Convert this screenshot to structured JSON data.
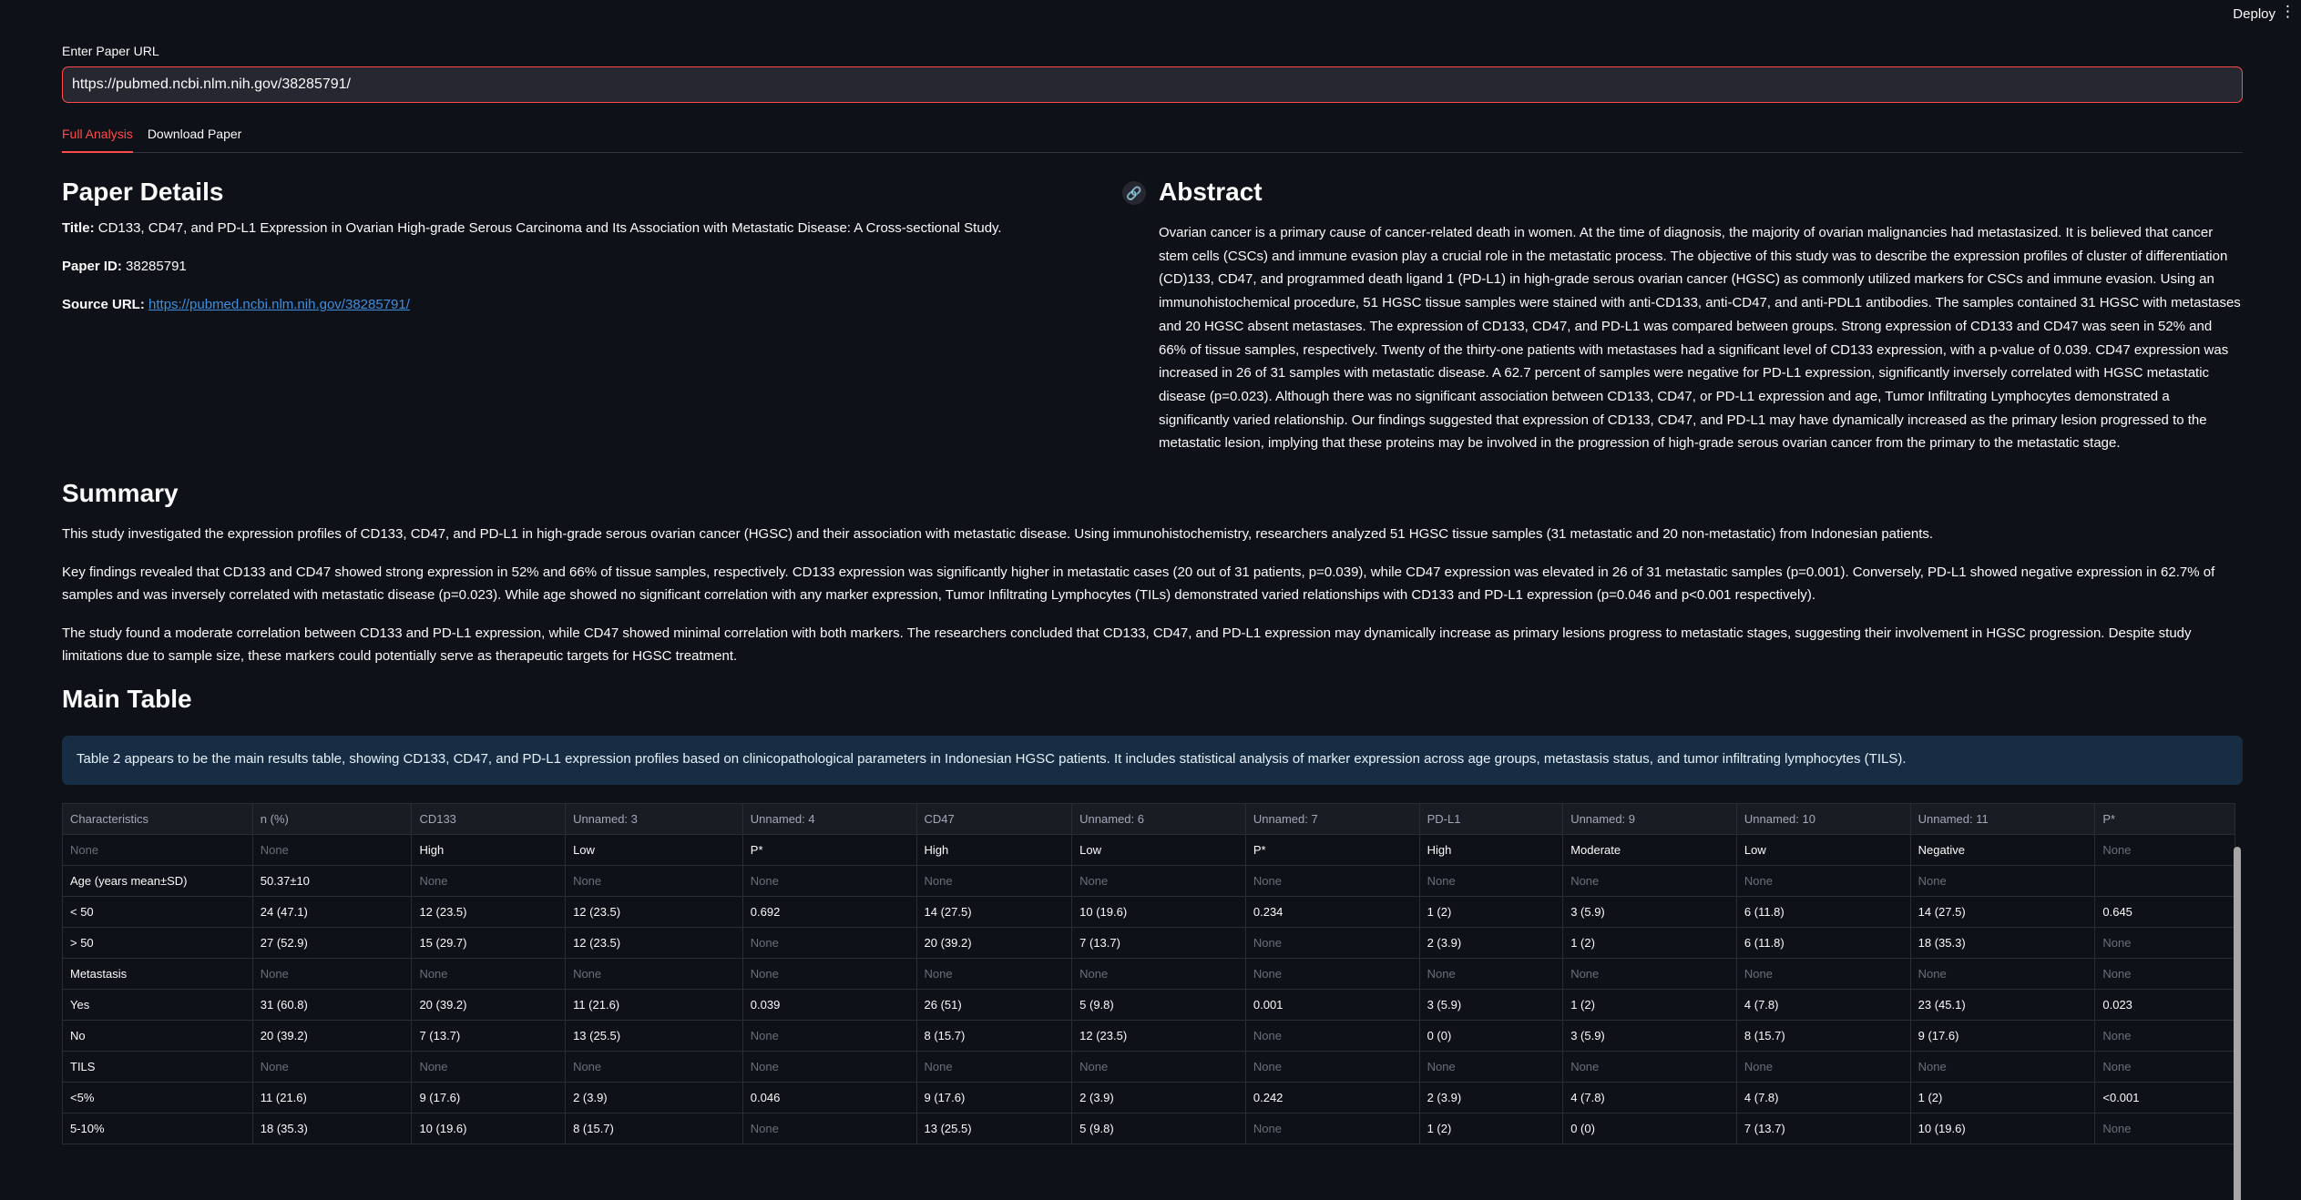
{
  "topbar": {
    "deploy": "Deploy",
    "menu": "⋮"
  },
  "url_field": {
    "label": "Enter Paper URL",
    "value": "https://pubmed.ncbi.nlm.nih.gov/38285791/"
  },
  "tabs": [
    {
      "label": "Full Analysis",
      "active": true
    },
    {
      "label": "Download Paper",
      "active": false
    }
  ],
  "paper_details": {
    "heading": "Paper Details",
    "title_label": "Title:",
    "title": "CD133, CD47, and PD-L1 Expression in Ovarian High-grade Serous Carcinoma and Its Association with Metastatic Disease: A Cross-sectional Study.",
    "id_label": "Paper ID:",
    "id": "38285791",
    "source_label": "Source URL:",
    "source_url": "https://pubmed.ncbi.nlm.nih.gov/38285791/"
  },
  "abstract": {
    "heading": "Abstract",
    "text": "Ovarian cancer is a primary cause of cancer-related death in women. At the time of diagnosis, the majority of ovarian malignancies had metastasized. It is believed that cancer stem cells (CSCs) and immune evasion play a crucial role in the metastatic process. The objective of this study was to describe the expression profiles of cluster of differentiation (CD)133, CD47, and programmed death ligand 1 (PD-L1) in high-grade serous ovarian cancer (HGSC) as commonly utilized markers for CSCs and immune evasion. Using an immunohistochemical procedure, 51 HGSC tissue samples were stained with anti-CD133, anti-CD47, and anti-PDL1 antibodies. The samples contained 31 HGSC with metastases and 20 HGSC absent metastases. The expression of CD133, CD47, and PD-L1 was compared between groups. Strong expression of CD133 and CD47 was seen in 52% and 66% of tissue samples, respectively. Twenty of the thirty-one patients with metastases had a significant level of CD133 expression, with a p-value of 0.039. CD47 expression was increased in 26 of 31 samples with metastatic disease. A 62.7 percent of samples were negative for PD-L1 expression, significantly inversely correlated with HGSC metastatic disease (p=0.023). Although there was no significant association between CD133, CD47, or PD-L1 expression and age, Tumor Infiltrating Lymphocytes demonstrated a significantly varied relationship. Our findings suggested that expression of CD133, CD47, and PD-L1 may have dynamically increased as the primary lesion progressed to the metastatic lesion, implying that these proteins may be involved in the progression of high-grade serous ovarian cancer from the primary to the metastatic stage."
  },
  "summary": {
    "heading": "Summary",
    "paragraphs": [
      "This study investigated the expression profiles of CD133, CD47, and PD-L1 in high-grade serous ovarian cancer (HGSC) and their association with metastatic disease. Using immunohistochemistry, researchers analyzed 51 HGSC tissue samples (31 metastatic and 20 non-metastatic) from Indonesian patients.",
      "Key findings revealed that CD133 and CD47 showed strong expression in 52% and 66% of tissue samples, respectively. CD133 expression was significantly higher in metastatic cases (20 out of 31 patients, p=0.039), while CD47 expression was elevated in 26 of 31 metastatic samples (p=0.001). Conversely, PD-L1 showed negative expression in 62.7% of samples and was inversely correlated with metastatic disease (p=0.023). While age showed no significant correlation with any marker expression, Tumor Infiltrating Lymphocytes (TILs) demonstrated varied relationships with CD133 and PD-L1 expression (p=0.046 and p<0.001 respectively).",
      "The study found a moderate correlation between CD133 and PD-L1 expression, while CD47 showed minimal correlation with both markers. The researchers concluded that CD133, CD47, and PD-L1 expression may dynamically increase as primary lesions progress to metastatic stages, suggesting their involvement in HGSC progression. Despite study limitations due to sample size, these markers could potentially serve as therapeutic targets for HGSC treatment."
    ]
  },
  "main_table": {
    "heading": "Main Table",
    "info": "Table 2 appears to be the main results table, showing CD133, CD47, and PD-L1 expression profiles based on clinicopathological parameters in Indonesian HGSC patients. It includes statistical analysis of marker expression across age groups, metastasis status, and tumor infiltrating lymphocytes (TILS).",
    "columns": [
      "Characteristics",
      "n (%)",
      "CD133",
      "Unnamed: 3",
      "Unnamed: 4",
      "CD47",
      "Unnamed: 6",
      "Unnamed: 7",
      "PD-L1",
      "Unnamed: 9",
      "Unnamed: 10",
      "Unnamed: 11",
      "P*"
    ],
    "rows": [
      [
        "None",
        "None",
        "High",
        "Low",
        "P*",
        "High",
        "Low",
        "P*",
        "High",
        "Moderate",
        "Low",
        "Negative",
        "None"
      ],
      [
        "Age (years mean±SD)",
        "50.37±10",
        "None",
        "None",
        "None",
        "None",
        "None",
        "None",
        "None",
        "None",
        "None",
        "None",
        ""
      ],
      [
        "< 50",
        "24 (47.1)",
        "12 (23.5)",
        "12 (23.5)",
        "0.692",
        "14 (27.5)",
        "10 (19.6)",
        "0.234",
        "1 (2)",
        "3 (5.9)",
        "6 (11.8)",
        "14 (27.5)",
        "0.645"
      ],
      [
        "> 50",
        "27 (52.9)",
        "15 (29.7)",
        "12 (23.5)",
        "None",
        "20 (39.2)",
        "7 (13.7)",
        "None",
        "2 (3.9)",
        "1 (2)",
        "6 (11.8)",
        "18 (35.3)",
        "None"
      ],
      [
        "Metastasis",
        "None",
        "None",
        "None",
        "None",
        "None",
        "None",
        "None",
        "None",
        "None",
        "None",
        "None",
        "None"
      ],
      [
        "Yes",
        "31 (60.8)",
        "20 (39.2)",
        "11 (21.6)",
        "0.039",
        "26 (51)",
        "5 (9.8)",
        "0.001",
        "3 (5.9)",
        "1 (2)",
        "4 (7.8)",
        "23 (45.1)",
        "0.023"
      ],
      [
        "No",
        "20 (39.2)",
        "7 (13.7)",
        "13 (25.5)",
        "None",
        "8 (15.7)",
        "12 (23.5)",
        "None",
        "0 (0)",
        "3 (5.9)",
        "8 (15.7)",
        "9 (17.6)",
        "None"
      ],
      [
        "TILS",
        "None",
        "None",
        "None",
        "None",
        "None",
        "None",
        "None",
        "None",
        "None",
        "None",
        "None",
        "None"
      ],
      [
        "<5%",
        "11 (21.6)",
        "9 (17.6)",
        "2 (3.9)",
        "0.046",
        "9 (17.6)",
        "2 (3.9)",
        "0.242",
        "2 (3.9)",
        "4 (7.8)",
        "4 (7.8)",
        "1 (2)",
        "<0.001"
      ],
      [
        "5-10%",
        "18 (35.3)",
        "10 (19.6)",
        "8 (15.7)",
        "None",
        "13 (25.5)",
        "5 (9.8)",
        "None",
        "1 (2)",
        "0 (0)",
        "7 (13.7)",
        "10 (19.6)",
        "None"
      ]
    ]
  }
}
